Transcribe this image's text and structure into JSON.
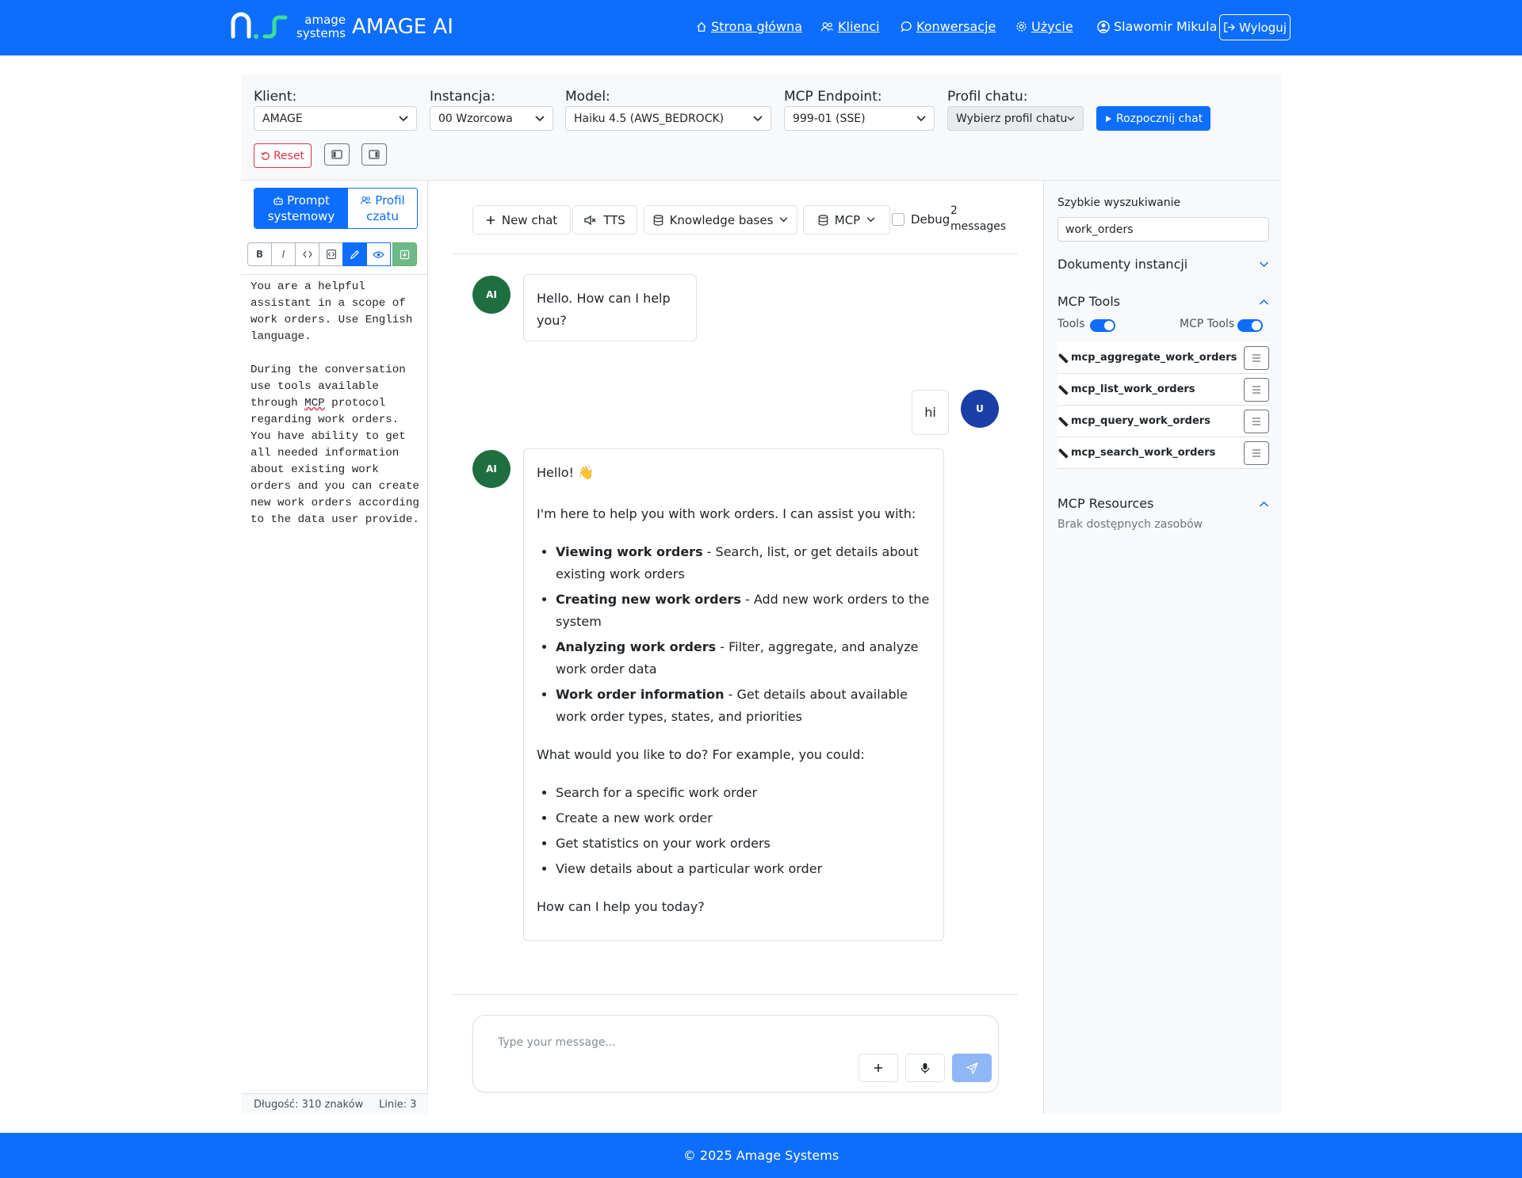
{
  "navbar": {
    "brand_small_line1": "amage",
    "brand_small_line2": "systems",
    "brand_main": "AMAGE AI",
    "links": {
      "home": "Strona główna",
      "clients": "Klienci",
      "conversations": "Konwersacje",
      "usage": "Użycie"
    },
    "user_name": "Slawomir Mikula",
    "logout_label": "Wyloguj",
    "icons": [
      "home-icon",
      "people-icon",
      "chat-icon",
      "gear-icon",
      "user-circle-icon",
      "logout-icon"
    ]
  },
  "toolbar": {
    "client_label": "Klient:",
    "client_value": "AMAGE",
    "instance_label": "Instancja:",
    "instance_value": "00 Wzorcowa",
    "model_label": "Model:",
    "model_value": "Haiku 4.5 (AWS_BEDROCK)",
    "mcp_label": "MCP Endpoint:",
    "mcp_value": "999-01 (SSE)",
    "profile_label": "Profil chatu:",
    "profile_value": "Wybierz profil chatu",
    "start_label": "Rozpocznij chat",
    "reset_label": "Reset"
  },
  "left_panel": {
    "tab_prompt_line1": "Prompt",
    "tab_prompt_line2": "systemowy",
    "tab_profile_line1": "Profil",
    "tab_profile_line2": "czatu",
    "editor_tools": {
      "bold": "B",
      "italic": "I"
    },
    "prompt_part1": "You are a helpful\nassistant in a scope of\nwork orders. Use English\nlanguage.\n\nDuring the conversation\nuse tools available\nthrough ",
    "prompt_squiggle": "MCP",
    "prompt_part2": " protocol\nregarding work orders.\nYou have ability to get\nall needed information\nabout existing work\norders and you can create\nnew work orders according\nto the data user provide.",
    "length_text": "Długość: 310 znaków",
    "lines_text": "Linie: 3"
  },
  "chat": {
    "new_chat_label": "New chat",
    "tts_label": "TTS",
    "kb_label": "Knowledge bases",
    "mcp_label": "MCP",
    "debug_label": "Debug",
    "message_count": "2 messages",
    "messages": [
      {
        "role": "ai",
        "avatar": "AI",
        "text": "Hello. How can I help you?"
      },
      {
        "role": "user",
        "avatar": "U",
        "text": "hi"
      },
      {
        "role": "ai",
        "avatar": "AI",
        "greeting": "Hello! 👋",
        "intro": "I'm here to help you with work orders. I can assist you with:",
        "capabilities": [
          {
            "title": "Viewing work orders",
            "desc": " - Search, list, or get details about existing work orders"
          },
          {
            "title": "Creating new work orders",
            "desc": " - Add new work orders to the system"
          },
          {
            "title": "Analyzing work orders",
            "desc": " - Filter, aggregate, and analyze work order data"
          },
          {
            "title": "Work order information",
            "desc": " - Get details about available work order types, states, and priorities"
          }
        ],
        "question": "What would you like to do? For example, you could:",
        "examples": [
          "Search for a specific work order",
          "Create a new work order",
          "Get statistics on your work orders",
          "View details about a particular work order"
        ],
        "closing": "How can I help you today?"
      }
    ],
    "input_placeholder": "Type your message..."
  },
  "right_panel": {
    "quick_search_label": "Szybkie wyszukiwanie",
    "quick_search_value": "work_orders",
    "instance_docs_label": "Dokumenty instancji",
    "mcp_tools_label": "MCP Tools",
    "tools_switch_label": "Tools",
    "mcp_tools_switch_label": "MCP Tools",
    "tools_switch_on": true,
    "mcp_tools_switch_on": true,
    "tools": [
      "mcp_aggregate_work_orders",
      "mcp_list_work_orders",
      "mcp_query_work_orders",
      "mcp_search_work_orders"
    ],
    "mcp_resources_label": "MCP Resources",
    "resources_empty": "Brak dostępnych zasobów"
  },
  "footer": {
    "copyright": "© 2025 Amage Systems"
  },
  "colors": {
    "primary": "#0d6efd",
    "ai_avatar": "#1f6e3f",
    "user_avatar": "#1a3fa6",
    "danger": "#dc3545"
  }
}
